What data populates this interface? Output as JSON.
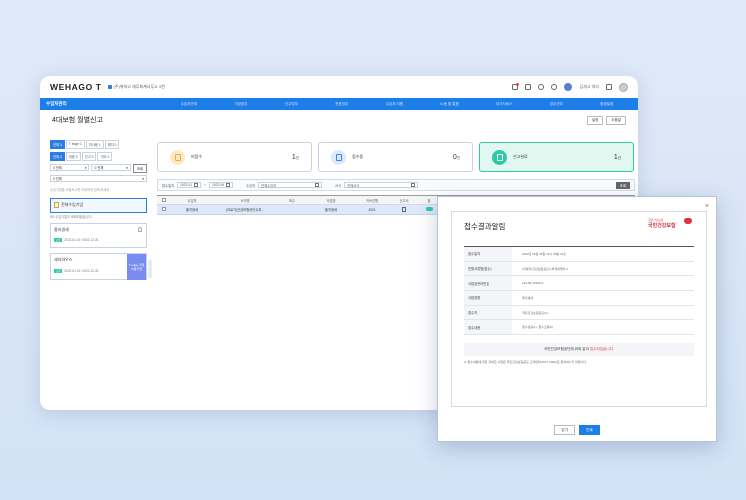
{
  "app": {
    "logo": "WEHAGO T",
    "company": "(주)위하고 세무회계사무소 1번",
    "user": "김세고 대리"
  },
  "nav": {
    "title": "수임처관리",
    "items": [
      "수임처관리",
      "기장업무",
      "신고업무",
      "전표업무",
      "수임처 지원",
      "노동 및 통합",
      "부가서비스",
      "업무관리",
      "환경설정"
    ]
  },
  "page": {
    "title": "4대보험 월별신고",
    "buttons": [
      "설정",
      "도움말"
    ]
  },
  "left": {
    "tabs1": [
      "전체 3",
      "T edge 1",
      "미사용 1",
      "해지 0"
    ],
    "tabs2": [
      "전체 0",
      "미동 2",
      "신고 0",
      "기타 0"
    ],
    "select1": "0 전체",
    "select2": "0 전체",
    "lookup": "조회",
    "select3": "0 전체",
    "hint": "수임기업을 서팅하시면 자세하게 검색 하세요.",
    "cards": [
      {
        "title": "전체수임기업",
        "sub": "0/0 수임기업이 조회되었습니다."
      },
      {
        "title": "울지생세",
        "badge": "오류",
        "sub": "2022-01-01~2022-12-31"
      },
      {
        "title": "세자하우스",
        "badge": "오류",
        "sub": "2022-01-01~2022-12-31",
        "tag": "T edge 기업",
        "tag_sub": "이용기업"
      }
    ]
  },
  "stats": [
    {
      "label": "미접수",
      "count": "1",
      "unit": "건",
      "color": "#f4a93b"
    },
    {
      "label": "접수중",
      "count": "0",
      "unit": "건",
      "color": "#3b86e8"
    },
    {
      "label": "신고완료",
      "count": "1",
      "unit": "건",
      "color": "#2cc9a5"
    }
  ],
  "filter": {
    "label1": "접수일자",
    "from": "2022.01",
    "to": "2022.06",
    "label2": "수임처",
    "value2": "전체수임처",
    "label3": "서식",
    "value3": "전체서식",
    "search": "조회"
  },
  "table": {
    "headers": [
      "수임처",
      "서식명",
      "파수",
      "사업장",
      "귀속연월",
      "신고서",
      "정"
    ],
    "rows": [
      [
        "울지생세",
        "(의료기)건강보험공단수부...",
        "",
        "울지생세",
        "2021",
        "",
        ""
      ]
    ]
  },
  "dialog": {
    "title": "접수결과알림",
    "org_small": "국민건강보험",
    "org_big": "국민건강보험",
    "rows": [
      {
        "label": "접수일자",
        "value": "2022년 05월 09일 19시 45분 23초"
      },
      {
        "label": "민원서류명(접수)",
        "value": "(자영자)건강보험공단수부계획명서 2"
      },
      {
        "label": "사업장관리번호",
        "value": "123-86-10100-0"
      },
      {
        "label": "사업장명",
        "value": "울지생세"
      },
      {
        "label": "접수자",
        "value": "국민건강보험공단(1)"
      },
      {
        "label": "접수내용",
        "value": "접수성공(1), 접수오류(0)"
      }
    ],
    "notice_pre": "국민건강보험공단에 위와 같이",
    "notice_red": "접수되었습니다.",
    "footnote": "※ 접수내용에 대한 자세한 사항은 국민건강보험공단 고객센터(1577-1000)로 문의하시기 바랍니다.",
    "buttons": [
      "닫기",
      "인쇄"
    ]
  }
}
